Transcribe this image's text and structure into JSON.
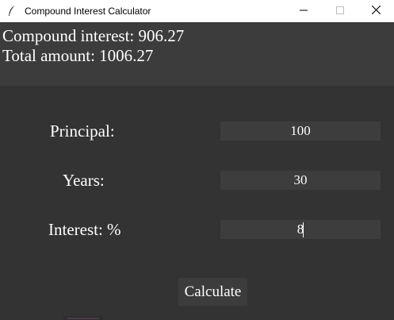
{
  "window": {
    "title": "Compound Interest Calculator",
    "icons": {
      "app": "feather-icon",
      "minimize": "minimize-icon",
      "maximize": "maximize-icon",
      "close": "close-icon"
    }
  },
  "results": {
    "compound_interest": "Compound interest: 906.27",
    "total_amount": "Total amount: 1006.27"
  },
  "form": {
    "principal_label": "Principal:",
    "principal_value": "100",
    "years_label": "Years:",
    "years_value": "30",
    "interest_label": "Interest: %",
    "interest_value": "8"
  },
  "actions": {
    "calculate_label": "Calculate"
  },
  "colors": {
    "background": "#333333",
    "results_panel": "#3c3c3c",
    "field_bg": "#3d3d3d",
    "text": "#ffffff",
    "titlebar": "#ffffff"
  }
}
